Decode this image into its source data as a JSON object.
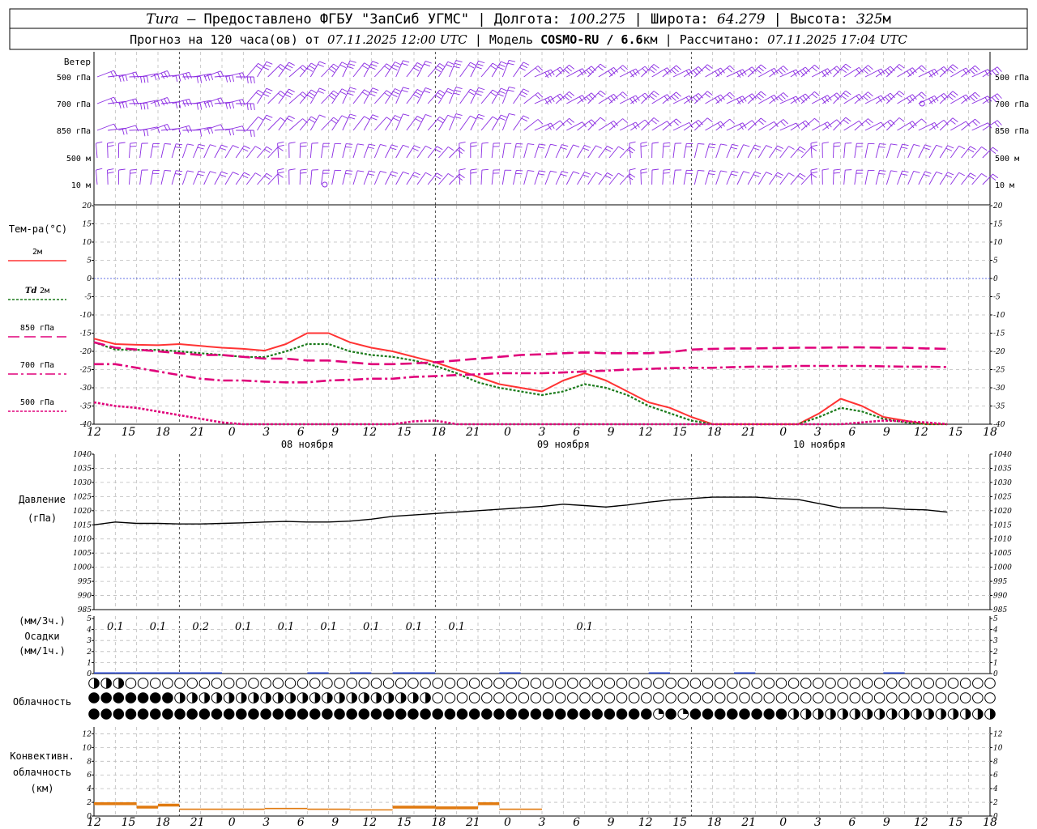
{
  "header": {
    "station": "Tura",
    "provider": "– Предоставлено ФГБУ \"ЗапСиб УГМС\"",
    "lon_label": "Долгота:",
    "lon": "100.275",
    "lat_label": "Широта:",
    "lat": "64.279",
    "alt_label": "Высота:",
    "alt": "325",
    "alt_unit": "м",
    "forecast_label": "Прогноз на 120 часа(ов) от",
    "forecast_start": "07.11.2025 12:00 UTC",
    "model_label": "Модель",
    "model": "COSMO-RU / 6.6",
    "model_unit": "км",
    "calc_label": "Рассчитано:",
    "calc_time": "07.11.2025 17:04 UTC"
  },
  "axis": {
    "hour_labels": [
      "12",
      "15",
      "18",
      "21",
      "0",
      "3",
      "6",
      "9",
      "12",
      "15",
      "18",
      "21",
      "0",
      "3",
      "6",
      "9",
      "12",
      "15",
      "18",
      "21",
      "0",
      "3",
      "6",
      "9",
      "12",
      "15",
      "18"
    ],
    "date_labels": [
      "08 ноября",
      "09 ноября",
      "10 ноября"
    ]
  },
  "panels": {
    "wind": {
      "title": "Ветер",
      "levels": [
        "500 гПа",
        "700 гПа",
        "850 гПа",
        "500 м",
        "10 м"
      ],
      "barb_color": "#8a2be2"
    },
    "temperature": {
      "title": "Тем-ра(°С)",
      "legend": [
        {
          "key": "t2m",
          "prefix": "",
          "label": "2м",
          "color": "#ff3333",
          "dash": ""
        },
        {
          "key": "td2m",
          "prefix": "Td",
          "label": "2м",
          "color": "#1a7a1a",
          "dash": "3,2"
        },
        {
          "key": "t850",
          "prefix": "",
          "label": "850 гПа",
          "color": "#e0007a",
          "dash": "14,6"
        },
        {
          "key": "t700",
          "prefix": "",
          "label": "700 гПа",
          "color": "#e0007a",
          "dash": "12,4,3,4"
        },
        {
          "key": "t500",
          "prefix": "",
          "label": "500 гПа",
          "color": "#e0007a",
          "dash": "3,2"
        }
      ],
      "ticks": [
        "20",
        "15",
        "10",
        "5",
        "0",
        "-5",
        "-10",
        "-15",
        "-20",
        "-25",
        "-30",
        "-35",
        "-40"
      ]
    },
    "pressure": {
      "title": "Давление",
      "unit": "(гПа)",
      "ticks": [
        "1040",
        "1035",
        "1030",
        "1025",
        "1020",
        "1015",
        "1010",
        "1005",
        "1000",
        "995",
        "990",
        "985"
      ]
    },
    "precipitation": {
      "label3h": "(мм/3ч.)",
      "title": "Осадки",
      "label1h": "(мм/1ч.)",
      "ticks": [
        "5",
        "4",
        "3",
        "2",
        "1",
        "0"
      ],
      "totals": [
        "0.1",
        "0.1",
        "0.2",
        "0.1",
        "0.1",
        "0.1",
        "0.1",
        "0.1",
        "0.1",
        "0.1"
      ]
    },
    "cloud": {
      "title": "Облачность"
    },
    "convective": {
      "title1": "Конвективн.",
      "title2": "облачность",
      "unit": "(км)",
      "ticks": [
        "12",
        "10",
        "8",
        "6",
        "4",
        "2",
        "0"
      ]
    }
  },
  "chart_data": [
    {
      "type": "line",
      "name": "temperature",
      "x_hours": [
        0,
        3,
        6,
        9,
        12,
        15,
        18,
        21,
        24,
        27,
        30,
        33,
        36,
        39,
        42,
        45,
        48,
        51,
        54,
        57,
        60,
        63,
        66,
        69,
        72,
        75,
        78,
        81,
        84,
        87,
        90,
        93,
        96,
        99,
        102,
        105,
        108,
        111,
        114,
        117,
        120
      ],
      "ylim": [
        -40,
        20
      ],
      "series": [
        {
          "name": "2м",
          "values": [
            -16.5,
            -18,
            -18.2,
            -18.3,
            -18,
            -18.5,
            -19,
            -19.3,
            -19.8,
            -18,
            -15,
            -15,
            -17.5,
            -19,
            -20,
            -21.5,
            -23,
            -25,
            -27,
            -29,
            -30,
            -31,
            -28,
            -26,
            -28,
            -31,
            -34,
            -35.5,
            -38,
            -40,
            -40,
            -40,
            -40,
            -40,
            -37,
            -33,
            -35,
            -38,
            -39,
            -40,
            -40
          ]
        },
        {
          "name": "Td 2м",
          "values": [
            -17.5,
            -19.5,
            -19.6,
            -19.6,
            -20,
            -20.5,
            -21,
            -21.5,
            -21.6,
            -20,
            -18,
            -18,
            -20,
            -21,
            -21.5,
            -22.5,
            -24,
            -26,
            -28.5,
            -30,
            -31,
            -32,
            -31,
            -29,
            -30,
            -32,
            -35,
            -37,
            -39,
            -40,
            -40,
            -40,
            -40,
            -40,
            -38,
            -35.5,
            -36.5,
            -38.5,
            -39.5,
            -40,
            -40
          ]
        },
        {
          "name": "850 гПа",
          "values": [
            -17.5,
            -19,
            -19.5,
            -20,
            -20.5,
            -21,
            -21,
            -21.5,
            -22,
            -22,
            -22.5,
            -22.5,
            -23,
            -23.5,
            -23.5,
            -23.3,
            -23,
            -22.5,
            -22,
            -21.5,
            -21,
            -20.8,
            -20.5,
            -20.3,
            -20.5,
            -20.5,
            -20.5,
            -20.2,
            -19.5,
            -19.3,
            -19.2,
            -19.2,
            -19.1,
            -19,
            -19,
            -18.9,
            -18.9,
            -19,
            -19,
            -19.2,
            -19.3
          ]
        },
        {
          "name": "700 гПа",
          "values": [
            -23.5,
            -23.5,
            -24.5,
            -25.5,
            -26.5,
            -27.5,
            -28,
            -28,
            -28.3,
            -28.5,
            -28.5,
            -28,
            -27.8,
            -27.5,
            -27.5,
            -27,
            -26.8,
            -26.5,
            -26.3,
            -26,
            -26,
            -26,
            -25.8,
            -25.5,
            -25.3,
            -25,
            -24.8,
            -24.6,
            -24.5,
            -24.5,
            -24.3,
            -24.2,
            -24.2,
            -24,
            -24,
            -24,
            -24,
            -24.1,
            -24.2,
            -24.2,
            -24.3
          ]
        },
        {
          "name": "500 гПа",
          "values": [
            -34,
            -35,
            -35.5,
            -36.5,
            -37.5,
            -38.5,
            -39.5,
            -40,
            -40,
            -40,
            -40,
            -40,
            -40,
            -40,
            -40,
            -39.2,
            -39,
            -40,
            -40,
            -40,
            -40,
            -40,
            -40,
            -40,
            -40,
            -40,
            -40,
            -40,
            -40,
            -40,
            -40,
            -40,
            -40,
            -40,
            -40,
            -40,
            -39.5,
            -39,
            -39.2,
            -39.5,
            -40
          ]
        }
      ]
    },
    {
      "type": "line",
      "name": "pressure",
      "x_hours": [
        0,
        3,
        6,
        9,
        12,
        15,
        18,
        21,
        24,
        27,
        30,
        33,
        36,
        39,
        42,
        45,
        48,
        51,
        54,
        57,
        60,
        63,
        66,
        69,
        72,
        75,
        78,
        81,
        84,
        87,
        90,
        93,
        96,
        99,
        102,
        105,
        108,
        111,
        114,
        117,
        120
      ],
      "ylim": [
        985,
        1040
      ],
      "values": [
        1015,
        1016,
        1015.5,
        1015.5,
        1015.3,
        1015.3,
        1015.5,
        1015.7,
        1016,
        1016.2,
        1016,
        1016,
        1016.3,
        1017,
        1018,
        1018.5,
        1019,
        1019.5,
        1020,
        1020.5,
        1021,
        1021.5,
        1022.3,
        1021.8,
        1021.3,
        1022,
        1023,
        1023.8,
        1024.3,
        1024.8,
        1024.8,
        1024.8,
        1024.3,
        1024,
        1022.5,
        1021,
        1021,
        1021,
        1020.5,
        1020.3,
        1019.5
      ]
    },
    {
      "type": "bar",
      "name": "precipitation",
      "ylim": [
        0,
        5
      ],
      "x_hours": [
        3,
        6,
        9,
        12,
        15,
        18,
        21,
        24,
        27,
        30,
        33,
        36,
        39,
        42,
        45,
        48,
        51,
        54,
        57,
        60,
        63,
        66,
        69,
        72,
        75,
        78,
        81,
        84,
        87,
        90,
        93,
        96,
        99,
        102,
        105,
        108,
        111,
        114,
        117,
        120
      ],
      "values": [
        0.05,
        0.05,
        0.1,
        0.1,
        0.05,
        0.05,
        0,
        0,
        0,
        0,
        0.05,
        0,
        0.03,
        0,
        0.03,
        0.03,
        0,
        0,
        0,
        0.03,
        0,
        0,
        0,
        0,
        0,
        0,
        0.03,
        0,
        0,
        0,
        0.03,
        0,
        0,
        0,
        0,
        0,
        0,
        0.03,
        0,
        0
      ]
    },
    {
      "type": "line",
      "name": "convective_cloud",
      "ylim": [
        0,
        13
      ],
      "x_hours": [
        0,
        3,
        6,
        9,
        12,
        15,
        18,
        21,
        24,
        27,
        30,
        33,
        36,
        39,
        42,
        45,
        48,
        51,
        54,
        57,
        60,
        63
      ],
      "values": [
        1.8,
        1.8,
        1.3,
        1.6,
        1,
        1,
        1,
        1,
        1.1,
        1.1,
        1,
        1,
        0.9,
        0.9,
        1.3,
        1.3,
        1.2,
        1.2,
        1.8,
        1.0,
        1.0,
        1.0
      ]
    }
  ]
}
